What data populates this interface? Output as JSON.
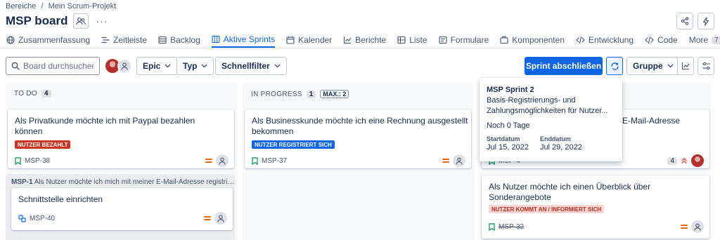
{
  "breadcrumb": {
    "items": [
      "Bereiche",
      "/",
      "Mein Scrum-Projekt"
    ]
  },
  "header": {
    "title": "MSP board"
  },
  "tabs": [
    {
      "label": "Zusammenfassung",
      "icon": "globe-icon"
    },
    {
      "label": "Zeitleiste",
      "icon": "timeline-icon"
    },
    {
      "label": "Backlog",
      "icon": "backlog-icon"
    },
    {
      "label": "Aktive Sprints",
      "icon": "board-icon",
      "active": true
    },
    {
      "label": "Kalender",
      "icon": "calendar-icon"
    },
    {
      "label": "Berichte",
      "icon": "chart-icon"
    },
    {
      "label": "Liste",
      "icon": "list-icon"
    },
    {
      "label": "Formulare",
      "icon": "form-icon"
    },
    {
      "label": "Komponenten",
      "icon": "component-icon"
    },
    {
      "label": "Entwicklung",
      "icon": "code-icon"
    },
    {
      "label": "Code",
      "icon": "code-icon"
    }
  ],
  "more_tab": {
    "label": "More",
    "count": "7"
  },
  "toolbar": {
    "search_placeholder": "Board durchsuchen",
    "epic_label": "Epic",
    "type_label": "Typ",
    "quickfilter_label": "Schnellfilter",
    "complete_sprint_label": "Sprint abschließen",
    "group_label": "Gruppe"
  },
  "columns": {
    "todo": {
      "name": "TO DO",
      "count": "4"
    },
    "inprogress": {
      "name": "IN PROGRESS",
      "count": "1",
      "max": "MAX.: 2"
    }
  },
  "cards": {
    "c1": {
      "text_line1": "Als Privatkunde möchte ich mit Paypal bezahlen",
      "text_line2": "können",
      "label": "NUTZER BEZAHLT",
      "key": "MSP-38"
    },
    "c2": {
      "text_line1": "Als Businesskunde möchte ich eine Rechnung ausgestellt",
      "text_line2": "bekommen",
      "label": "NUTZER REGISTRIERT SICH",
      "key": "MSP-37"
    },
    "c3": {
      "text_fragment": "E-Mail-Adresse",
      "key_fragment": "MSP-4",
      "count": "4"
    },
    "c4": {
      "text_line1": "Als Nutzer möchte ich einen Überblick über",
      "text_line2": "Sonderangebote",
      "label": "NUTZER KOMMT AN / INFORMIERT SICH",
      "key": "MSP-32"
    },
    "sub": {
      "text": "Schnittstelle einrichten",
      "key": "MSP-40"
    }
  },
  "epic_group": {
    "key": "MSP-1",
    "summary": "Als Nutzer möchte ich mich mit meiner E-Mail-Adresse registrieren..."
  },
  "sprint_tooltip": {
    "title": "MSP Sprint 2",
    "goal_line1": "Basis-Registrierungs- und",
    "goal_line2": "Zahlungsmöglichkeiten für Nutzer...",
    "remaining": "Noch 0 Tage",
    "start_label": "Startdatum",
    "start_value": "Jul 15, 2022",
    "end_label": "Enddatum",
    "end_value": "Jul 29, 2022"
  },
  "colors": {
    "accent": "#0c66e4",
    "priority": "#e56910",
    "label_red": "#ca3521",
    "label_pink": "#ffd5d2"
  }
}
